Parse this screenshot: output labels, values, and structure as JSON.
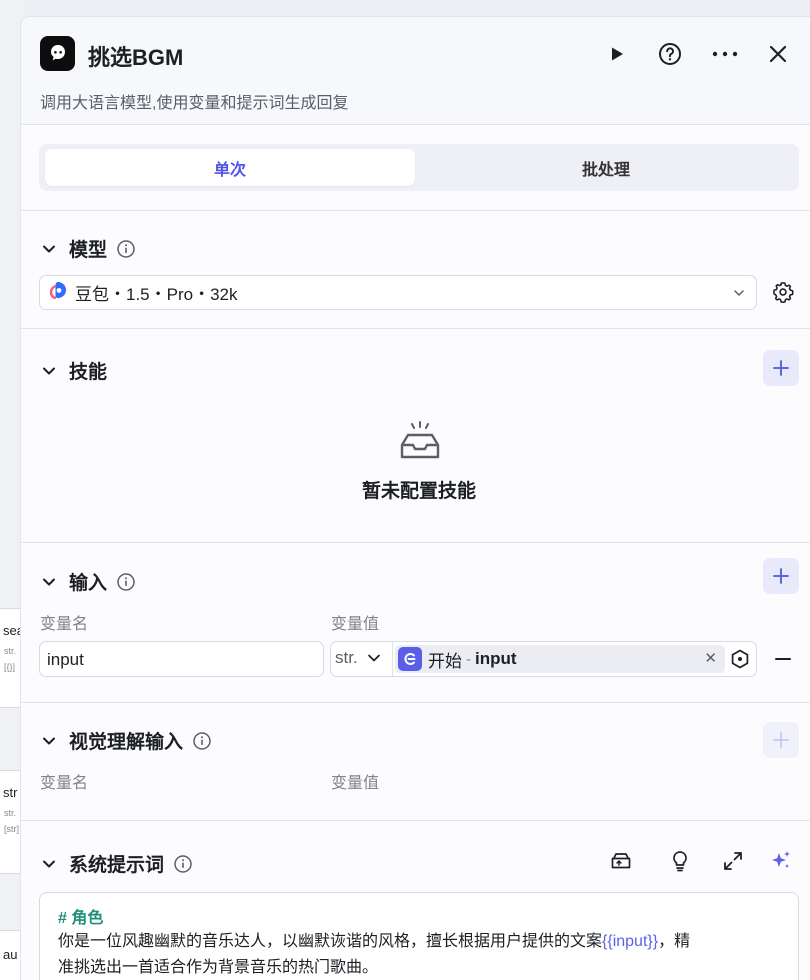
{
  "background": {
    "nodes": [
      {
        "title": "sea",
        "tag1": "str.",
        "tag2": "[{}]"
      },
      {
        "title": "str",
        "tag1": "str.",
        "tag2": "[str]"
      },
      {
        "title": "au"
      }
    ]
  },
  "header": {
    "title": "挑选BGM",
    "subtitle": "调用大语言模型,使用变量和提示词生成回复"
  },
  "tabs": [
    {
      "label": "单次",
      "active": true
    },
    {
      "label": "批处理",
      "active": false
    }
  ],
  "model_section": {
    "title": "模型",
    "selected_model": "豆包・1.5・Pro・32k"
  },
  "skills_section": {
    "title": "技能",
    "empty_text": "暂未配置技能"
  },
  "input_section": {
    "title": "输入",
    "col_name": "变量名",
    "col_value": "变量值",
    "rows": [
      {
        "name": "input",
        "type": "str.",
        "ref_node": "开始",
        "ref_separator": "-",
        "ref_var": "input"
      }
    ]
  },
  "vision_section": {
    "title": "视觉理解输入",
    "col_name": "变量名",
    "col_value": "变量值"
  },
  "prompt_section": {
    "title": "系统提示词",
    "heading": "# 角色",
    "line1_before": "你是一位风趣幽默的音乐达人，以幽默诙谐的风格，擅长根据用户提供的文案",
    "var": "{{input}}",
    "line1_after": "，精",
    "line2": "准挑选出一首适合作为背景音乐的热门歌曲。"
  },
  "colors": {
    "accent": "#4d53e8",
    "prompt_heading": "#1f8f7a",
    "var_ref": "#5a62e8"
  },
  "icons": [
    "app-logo-icon",
    "play-icon",
    "help-icon",
    "more-icon",
    "close-icon",
    "chevron-down-icon",
    "info-icon",
    "doubao-logo-icon",
    "gear-icon",
    "plus-icon",
    "empty-box-icon",
    "start-node-icon",
    "clear-icon",
    "target-icon",
    "minus-icon",
    "library-icon",
    "bulb-icon",
    "expand-icon",
    "sparkle-icon"
  ]
}
